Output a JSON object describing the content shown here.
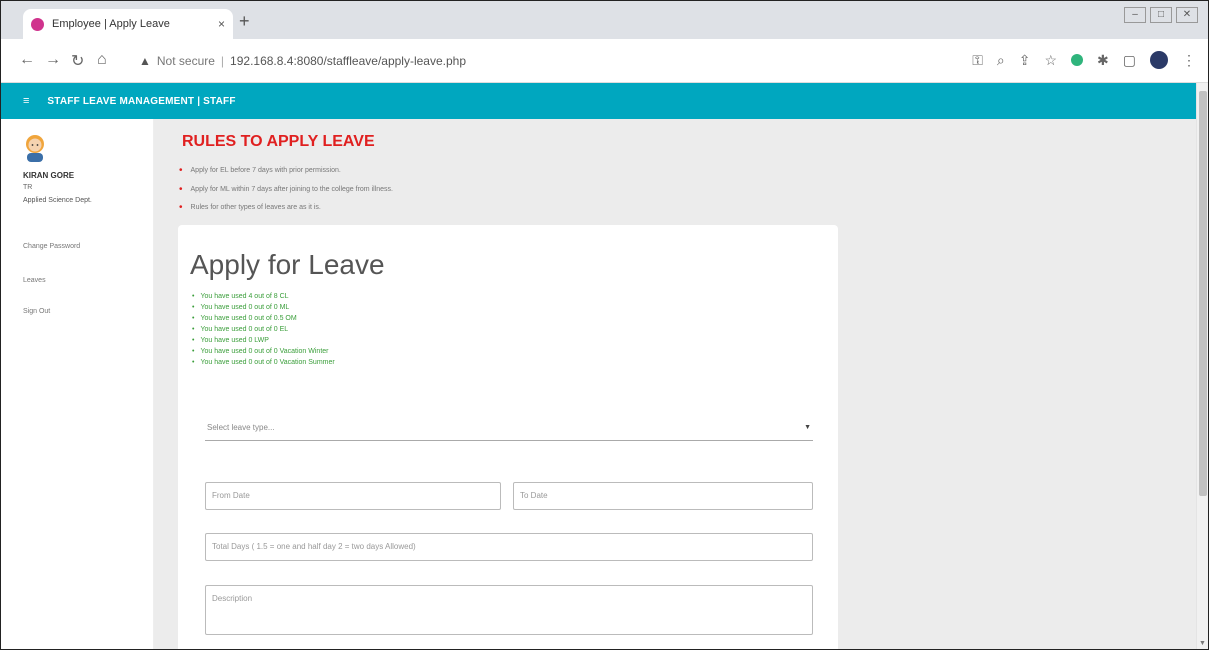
{
  "browser": {
    "tab_title": "Employee | Apply Leave",
    "tab_close": "×",
    "new_tab": "+",
    "security_label": "Not secure",
    "url": "192.168.8.4:8080/staffleave/apply-leave.php"
  },
  "app": {
    "title": "STAFF LEAVE MANAGEMENT | STAFF",
    "accent_color": "#00a7bf"
  },
  "sidebar": {
    "user_name": "KIRAN GORE",
    "user_role": "TR",
    "user_dept": "Applied Science Dept.",
    "links": [
      "Change Password",
      "Leaves",
      "Sign Out"
    ]
  },
  "rules": {
    "title": "RULES TO APPLY LEAVE",
    "items": [
      "Apply for EL before 7 days with prior permission.",
      "Apply for ML within 7 days after joining to the college from illness.",
      "Rules for other types of leaves are as it is."
    ]
  },
  "form": {
    "title": "Apply for Leave",
    "usage": [
      "You have used 4 out of 8 CL",
      "You have used 0 out of 0 ML",
      "You have used 0 out of 0.5 OM",
      "You have used 0 out of 0 EL",
      "You have used 0 LWP",
      "You have used 0 out of 0 Vacation Winter",
      "You have used 0 out of 0 Vacation Summer"
    ],
    "leave_type_placeholder": "Select leave type...",
    "from_date_placeholder": "From Date",
    "to_date_placeholder": "To Date",
    "total_days_placeholder": "Total Days ( 1.5 = one and half day 2 = two days Allowed)",
    "description_placeholder": "Description"
  }
}
